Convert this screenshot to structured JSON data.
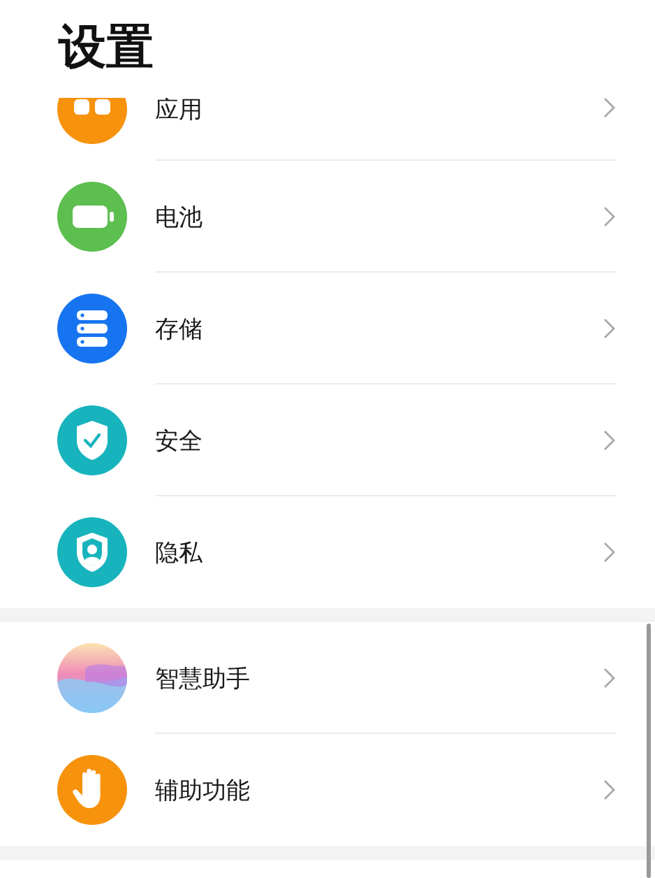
{
  "title": "设置",
  "sections": [
    {
      "items": [
        {
          "label": "应用",
          "kind": "apps",
          "cut_off": true
        },
        {
          "label": "电池",
          "kind": "battery",
          "cut_off": false
        },
        {
          "label": "存储",
          "kind": "storage",
          "cut_off": false
        },
        {
          "label": "安全",
          "kind": "security",
          "cut_off": false
        },
        {
          "label": "隐私",
          "kind": "privacy",
          "cut_off": false
        }
      ]
    },
    {
      "items": [
        {
          "label": "智慧助手",
          "kind": "assistant",
          "cut_off": false
        },
        {
          "label": "辅助功能",
          "kind": "accessibility",
          "cut_off": false
        }
      ]
    }
  ]
}
